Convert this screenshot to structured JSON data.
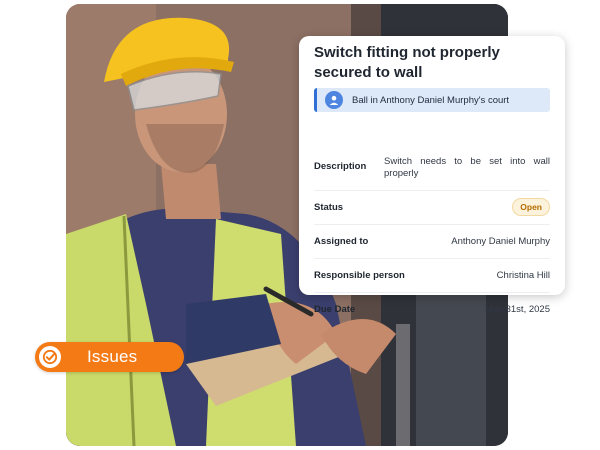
{
  "card": {
    "title": "Switch fitting not properly secured to wall",
    "ball_banner": "Ball in Anthony Daniel Murphy's court",
    "rows": {
      "description": {
        "label": "Description",
        "value": "Switch needs to be set into wall properly"
      },
      "status": {
        "label": "Status",
        "value": "Open"
      },
      "assigned_to": {
        "label": "Assigned to",
        "value": "Anthony Daniel Murphy"
      },
      "responsible_person": {
        "label": "Responsible person",
        "value": "Christina Hill"
      },
      "due_date": {
        "label": "Due Date",
        "value": "May 31st, 2025"
      }
    }
  },
  "issues_pill": {
    "label": "Issues"
  },
  "colors": {
    "accent_orange": "#f47a16",
    "banner_blue": "#dde8f8",
    "banner_border": "#2f6fd6",
    "status_open_bg": "#fdf3dc",
    "status_open_text": "#b36b00"
  },
  "icons": {
    "avatar": "person-icon",
    "issues": "check-circle-icon"
  }
}
